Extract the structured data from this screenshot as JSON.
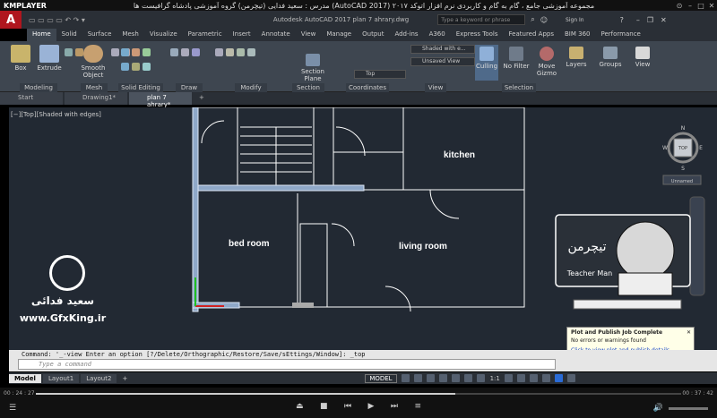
{
  "player": {
    "logo": "KMPLAYER",
    "title": "مجموعه آموزشی جامع ، گام به گام و کاربردی نرم افزار اتوکد ۲۰۱۷ (AutoCAD 2017) مدرس : سعید فدایی (تیچرمن) گروه آموزشی پادشاه گرافیست ها",
    "time_current": "00 : 24 : 27",
    "time_total": "00 : 37 : 42",
    "progress": 0.65
  },
  "acad": {
    "app_letter": "A",
    "doc_title": "Autodesk AutoCAD 2017 plan 7 ahrary.dwg",
    "search_placeholder": "Type a keyword or phrase",
    "signin": "Sign In"
  },
  "ribbon_tabs": [
    "Home",
    "Solid",
    "Surface",
    "Mesh",
    "Visualize",
    "Parametric",
    "Insert",
    "Annotate",
    "View",
    "Manage",
    "Output",
    "Add-ins",
    "A360",
    "Express Tools",
    "Featured Apps",
    "BIM 360",
    "Performance"
  ],
  "ribbon": {
    "box": "Box",
    "extrude": "Extrude",
    "smooth": "Smooth Object",
    "section_plane": "Section Plane",
    "visual_style": "Shaded with e...",
    "unsaved_view": "Unsaved View",
    "top": "Top",
    "culling": "Culling",
    "no_filter": "No Filter",
    "move_gizmo": "Move Gizmo",
    "layers": "Layers",
    "groups": "Groups",
    "view": "View",
    "groups_labels": [
      "Modeling",
      "Mesh",
      "Solid Editing",
      "Draw",
      "Modify",
      "Section",
      "Coordinates",
      "View",
      "Selection"
    ]
  },
  "doc_tabs": [
    "Start",
    "Drawing1*",
    "plan 7 ahrary*"
  ],
  "viewport_label": "[−][Top][Shaded with edges]",
  "rooms": {
    "kitchen": "kitchen",
    "bedroom": "bed room",
    "living": "living room"
  },
  "viewcube": {
    "top": "TOP",
    "n": "N",
    "s": "S",
    "e": "E",
    "w": "W",
    "wcs": "Unnamed"
  },
  "watermark": {
    "name": "سعید فدائی",
    "site": "www.GfxKing.ir",
    "teacher_fa": "تیچرمن",
    "teacher_en": "Teacher Man"
  },
  "command": {
    "history": "Command: '_-view Enter an option [?/Delete/Orthographic/Restore/Save/sEttings/Window]: _top",
    "placeholder": "Type a command"
  },
  "layout_tabs": [
    "Model",
    "Layout1",
    "Layout2"
  ],
  "status": {
    "model": "MODEL",
    "scale": "1:1"
  },
  "balloon": {
    "title": "Plot and Publish Job Complete",
    "line1": "No errors or warnings found",
    "link": "Click to view plot and publish details..."
  }
}
